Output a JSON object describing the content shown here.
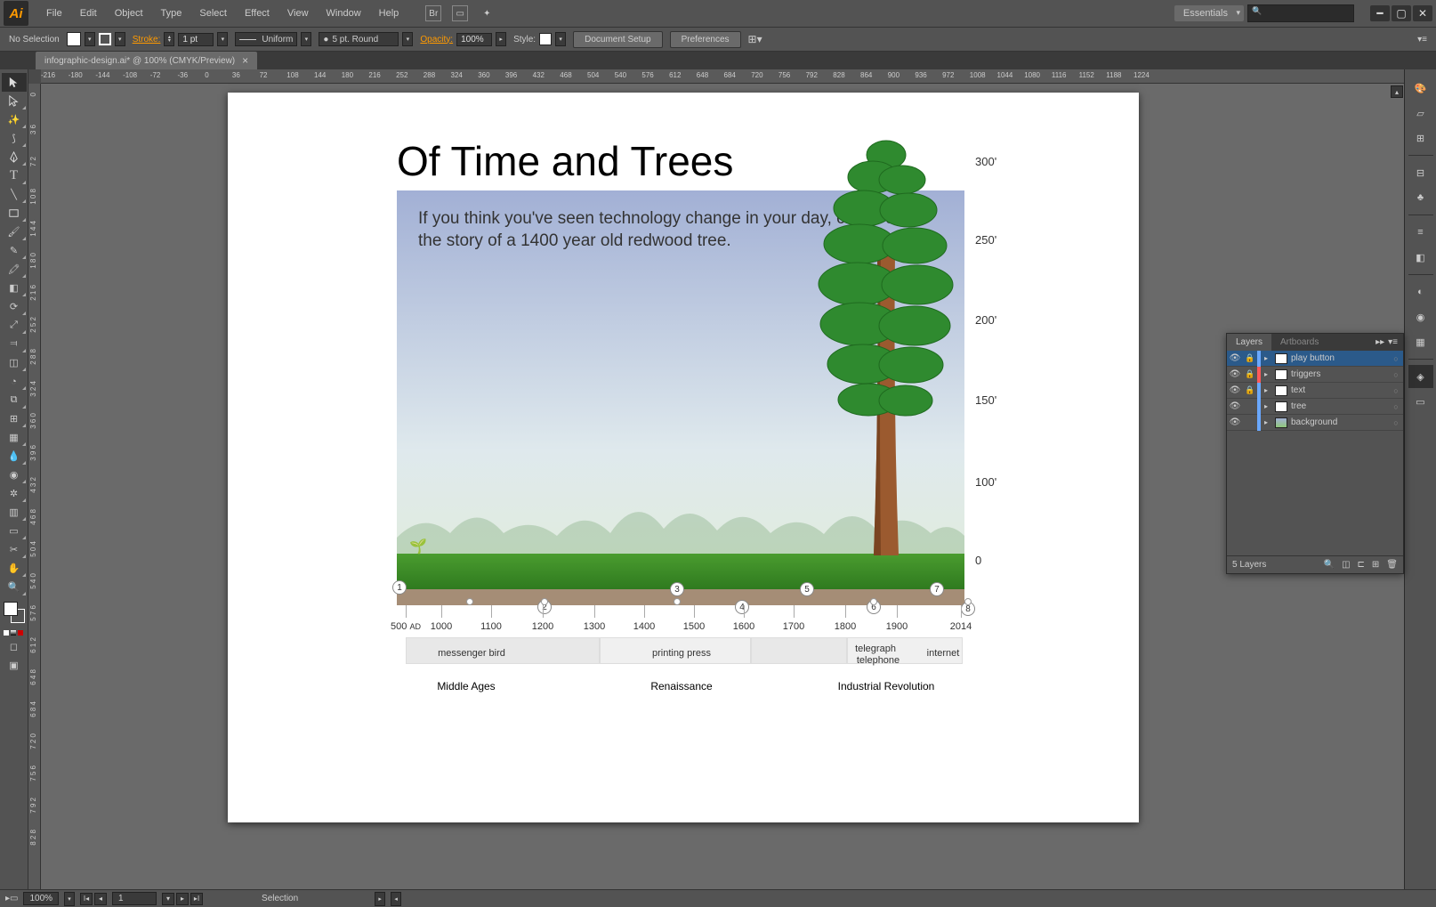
{
  "menubar": {
    "items": [
      "File",
      "Edit",
      "Object",
      "Type",
      "Select",
      "Effect",
      "View",
      "Window",
      "Help"
    ],
    "workspace": "Essentials"
  },
  "controlbar": {
    "selection": "No Selection",
    "stroke_label": "Stroke:",
    "stroke_weight": "1 pt",
    "stroke_profile": "Uniform",
    "brush": "5 pt. Round",
    "opacity_label": "Opacity:",
    "opacity_value": "100%",
    "style_label": "Style:",
    "doc_setup": "Document Setup",
    "preferences": "Preferences"
  },
  "filetab": {
    "name": "infographic-design.ai* @ 100% (CMYK/Preview)"
  },
  "ruler_h": [
    "-216",
    "-180",
    "-144",
    "-108",
    "-72",
    "-36",
    "0",
    "36",
    "72",
    "108",
    "144",
    "180",
    "216",
    "252",
    "288",
    "324",
    "360",
    "396",
    "432",
    "468",
    "504",
    "540",
    "576",
    "612",
    "648",
    "684",
    "720",
    "756",
    "792",
    "828",
    "864",
    "900",
    "936",
    "972",
    "1008",
    "1044",
    "1080",
    "1116",
    "1152",
    "1188",
    "1224"
  ],
  "ruler_v": [
    "0",
    "3 6",
    "7 2",
    "1 0 8",
    "1 4 4",
    "1 8 0",
    "2 1 6",
    "2 5 2",
    "2 8 8",
    "3 2 4",
    "3 6 0",
    "3 9 6",
    "4 3 2",
    "4 6 8",
    "5 0 4",
    "5 4 0",
    "5 7 6",
    "6 1 2",
    "6 4 8",
    "6 8 4",
    "7 2 0",
    "7 5 6",
    "7 9 2",
    "8 2 8"
  ],
  "infographic": {
    "title": "Of  Time and Trees",
    "subtitle": "If you think you've seen technology change in your day, check out the story of a 1400 year old redwood tree.",
    "heights": [
      "300'",
      "250'",
      "200'",
      "150'",
      "100'",
      "0"
    ],
    "markers": [
      "1",
      "2",
      "3",
      "4",
      "5",
      "6",
      "7",
      "8"
    ],
    "ticks": [
      "500 AD",
      "1000",
      "1100",
      "1200",
      "1300",
      "1400",
      "1500",
      "1600",
      "1700",
      "1800",
      "1900",
      "2014"
    ],
    "eras": [
      "Middle Ages",
      "Renaissance",
      "Industrial Revolution"
    ],
    "events": {
      "bird": "messenger bird",
      "press": "printing press",
      "tele1": "telegraph",
      "tele2": "telephone",
      "net": "internet"
    }
  },
  "layers": {
    "tab_layers": "Layers",
    "tab_artboards": "Artboards",
    "items": [
      {
        "name": "play button",
        "locked": true,
        "color": "#6aa8ff",
        "selected": true
      },
      {
        "name": "triggers",
        "locked": true,
        "color": "#ff5a5a"
      },
      {
        "name": "text",
        "locked": true,
        "color": "#6aa8ff"
      },
      {
        "name": "tree",
        "locked": false,
        "color": "#6aa8ff"
      },
      {
        "name": "background",
        "locked": false,
        "color": "#6aa8ff"
      }
    ],
    "footer": "5 Layers"
  },
  "statusbar": {
    "zoom": "100%",
    "artboard_nav": "1",
    "tool": "Selection"
  }
}
